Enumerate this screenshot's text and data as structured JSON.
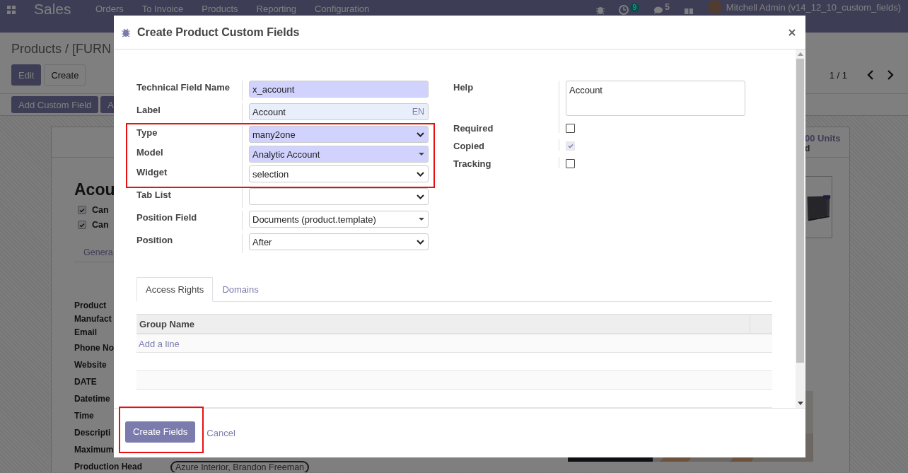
{
  "navbar": {
    "app_name": "Sales",
    "menu": [
      "Orders",
      "To Invoice",
      "Products",
      "Reporting",
      "Configuration"
    ],
    "activity_count": "9",
    "message_count": "5",
    "user": "Mitchell Admin (v14_12_10_custom_fields)"
  },
  "control_panel": {
    "breadcrumb": "Products / [FURN",
    "buttons": [
      {
        "label": "Edit",
        "primary": true
      },
      {
        "label": "Create",
        "primary": false
      }
    ],
    "pager": "1 / 1",
    "action_buttons": [
      "Add Custom Field",
      "A"
    ]
  },
  "sheet": {
    "stat_button": [
      "00 Units",
      "d"
    ],
    "title": "Acou",
    "options": [
      {
        "label": "Can",
        "checked": true
      },
      {
        "label": "Can",
        "checked": true
      }
    ],
    "tab": "Genera",
    "fields": [
      {
        "label": "Product\nManufact\nEmail"
      },
      {
        "label": "Phone No"
      },
      {
        "label": "Website"
      },
      {
        "label": "DATE"
      },
      {
        "label": "Datetime"
      },
      {
        "label": "Time"
      },
      {
        "label": "Descripti"
      },
      {
        "label": "Maximum"
      },
      {
        "label": "Production Head",
        "tags": [
          "Azure Interior, Brandon Freeman"
        ]
      }
    ]
  },
  "dialog": {
    "title": "Create Product Custom Fields",
    "left_fields": [
      {
        "label": "Technical Field Name",
        "kind": "input",
        "value": "x_account",
        "required": true,
        "highlighted": false
      },
      {
        "label": "Label",
        "kind": "translatable",
        "value": "Account",
        "lang": "EN",
        "required": false,
        "highlighted": false
      },
      {
        "label": "Type",
        "kind": "select",
        "value": "many2one",
        "required": true,
        "highlighted": true
      },
      {
        "label": "Model",
        "kind": "many2one",
        "value": "Analytic Account",
        "required": true,
        "highlighted": true
      },
      {
        "label": "Widget",
        "kind": "select",
        "value": "selection",
        "required": false,
        "highlighted": true
      },
      {
        "label": "Tab List",
        "kind": "select",
        "required": false,
        "highlighted": false
      },
      {
        "label": "Position Field",
        "kind": "many2one",
        "value": "Documents (product.template)",
        "required": false,
        "highlighted": false
      },
      {
        "label": "Position",
        "kind": "select",
        "value": "After",
        "required": false,
        "highlighted": false
      }
    ],
    "right_fields": [
      {
        "label": "Help",
        "kind": "textarea",
        "value": "Account"
      },
      {
        "label": "Required",
        "kind": "checkbox",
        "checked": false,
        "disabled": false
      },
      {
        "label": "Copied",
        "kind": "checkbox",
        "checked": true,
        "disabled": true
      },
      {
        "label": "Tracking",
        "kind": "checkbox",
        "checked": false,
        "disabled": false
      }
    ],
    "tabs": [
      {
        "label": "Access Rights",
        "selected": true
      },
      {
        "label": "Domains",
        "selected": false
      }
    ],
    "table": {
      "columns": [
        "Group Name"
      ],
      "add_line": "Add a line"
    },
    "footer": {
      "primary": {
        "label": "Create Fields",
        "highlighted": true
      },
      "cancel": "Cancel"
    }
  }
}
